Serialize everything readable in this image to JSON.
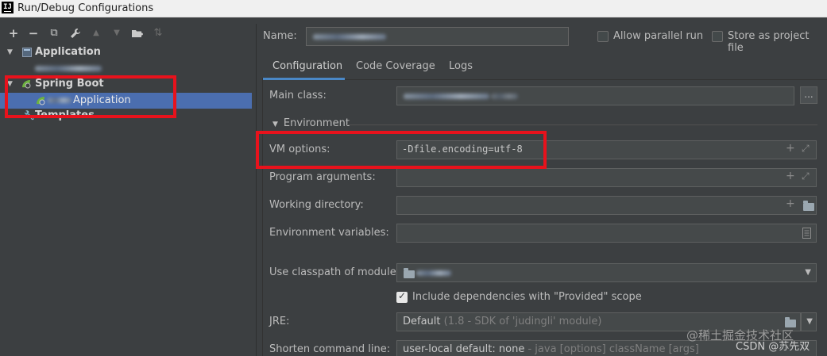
{
  "window": {
    "title": "Run/Debug Configurations",
    "app_icon": "IJ"
  },
  "toolbar": {
    "icons": [
      "add-icon",
      "remove-icon",
      "copy-icon",
      "wrench-icon",
      "move-up-icon",
      "move-down-icon",
      "folder-add-icon",
      "sort-icon"
    ],
    "glyphs": {
      "add": "+",
      "remove": "−",
      "copy": "⧉",
      "wrench": "🔧",
      "up": "▲",
      "down": "▼",
      "folder": "▇",
      "sort": "⇅"
    }
  },
  "tree": {
    "items": [
      {
        "label": "Application",
        "arrow": "▼",
        "bold": true
      },
      {
        "label": "",
        "blurred": true
      },
      {
        "label": "Spring Boot",
        "arrow": "▼",
        "bold": true
      },
      {
        "label": "Application",
        "selected": true,
        "blur_prefix": true
      },
      {
        "label": "Templates",
        "arrow": "",
        "bold": true
      }
    ]
  },
  "header": {
    "name_label": "Name:",
    "name_value": "",
    "allow_parallel_label": "Allow parallel run",
    "allow_parallel_checked": false,
    "store_as_project_label": "Store as project file",
    "store_as_project_checked": false
  },
  "tabs": [
    {
      "label": "Configuration",
      "active": true
    },
    {
      "label": "Code Coverage",
      "active": false
    },
    {
      "label": "Logs",
      "active": false
    }
  ],
  "config": {
    "main_class_label": "Main class:",
    "main_class_value": "",
    "browse_button": "...",
    "environment_label": "Environment",
    "vm_options_label": "VM options:",
    "vm_options_value": "-Dfile.encoding=utf-8",
    "program_arguments_label": "Program arguments:",
    "program_arguments_value": "",
    "working_directory_label": "Working directory:",
    "working_directory_value": "",
    "environment_variables_label": "Environment variables:",
    "environment_variables_value": "",
    "classpath_label": "Use classpath of module:",
    "classpath_value": "",
    "include_provided_label": "Include dependencies with \"Provided\" scope",
    "include_provided_checked": true,
    "jre_label": "JRE:",
    "jre_value": "Default",
    "jre_hint": "(1.8 - SDK of 'judingli' module)",
    "shorten_label": "Shorten command line:",
    "shorten_value": "user-local default: none",
    "shorten_hint": "- java [options] className [args]"
  },
  "watermark": {
    "line1": "@稀土掘金技术社区",
    "line2": "CSDN @苏先双"
  },
  "colors": {
    "annotation_red": "#e8121c",
    "selection_blue": "#4b6eaf",
    "tab_underline": "#4a88c7"
  }
}
